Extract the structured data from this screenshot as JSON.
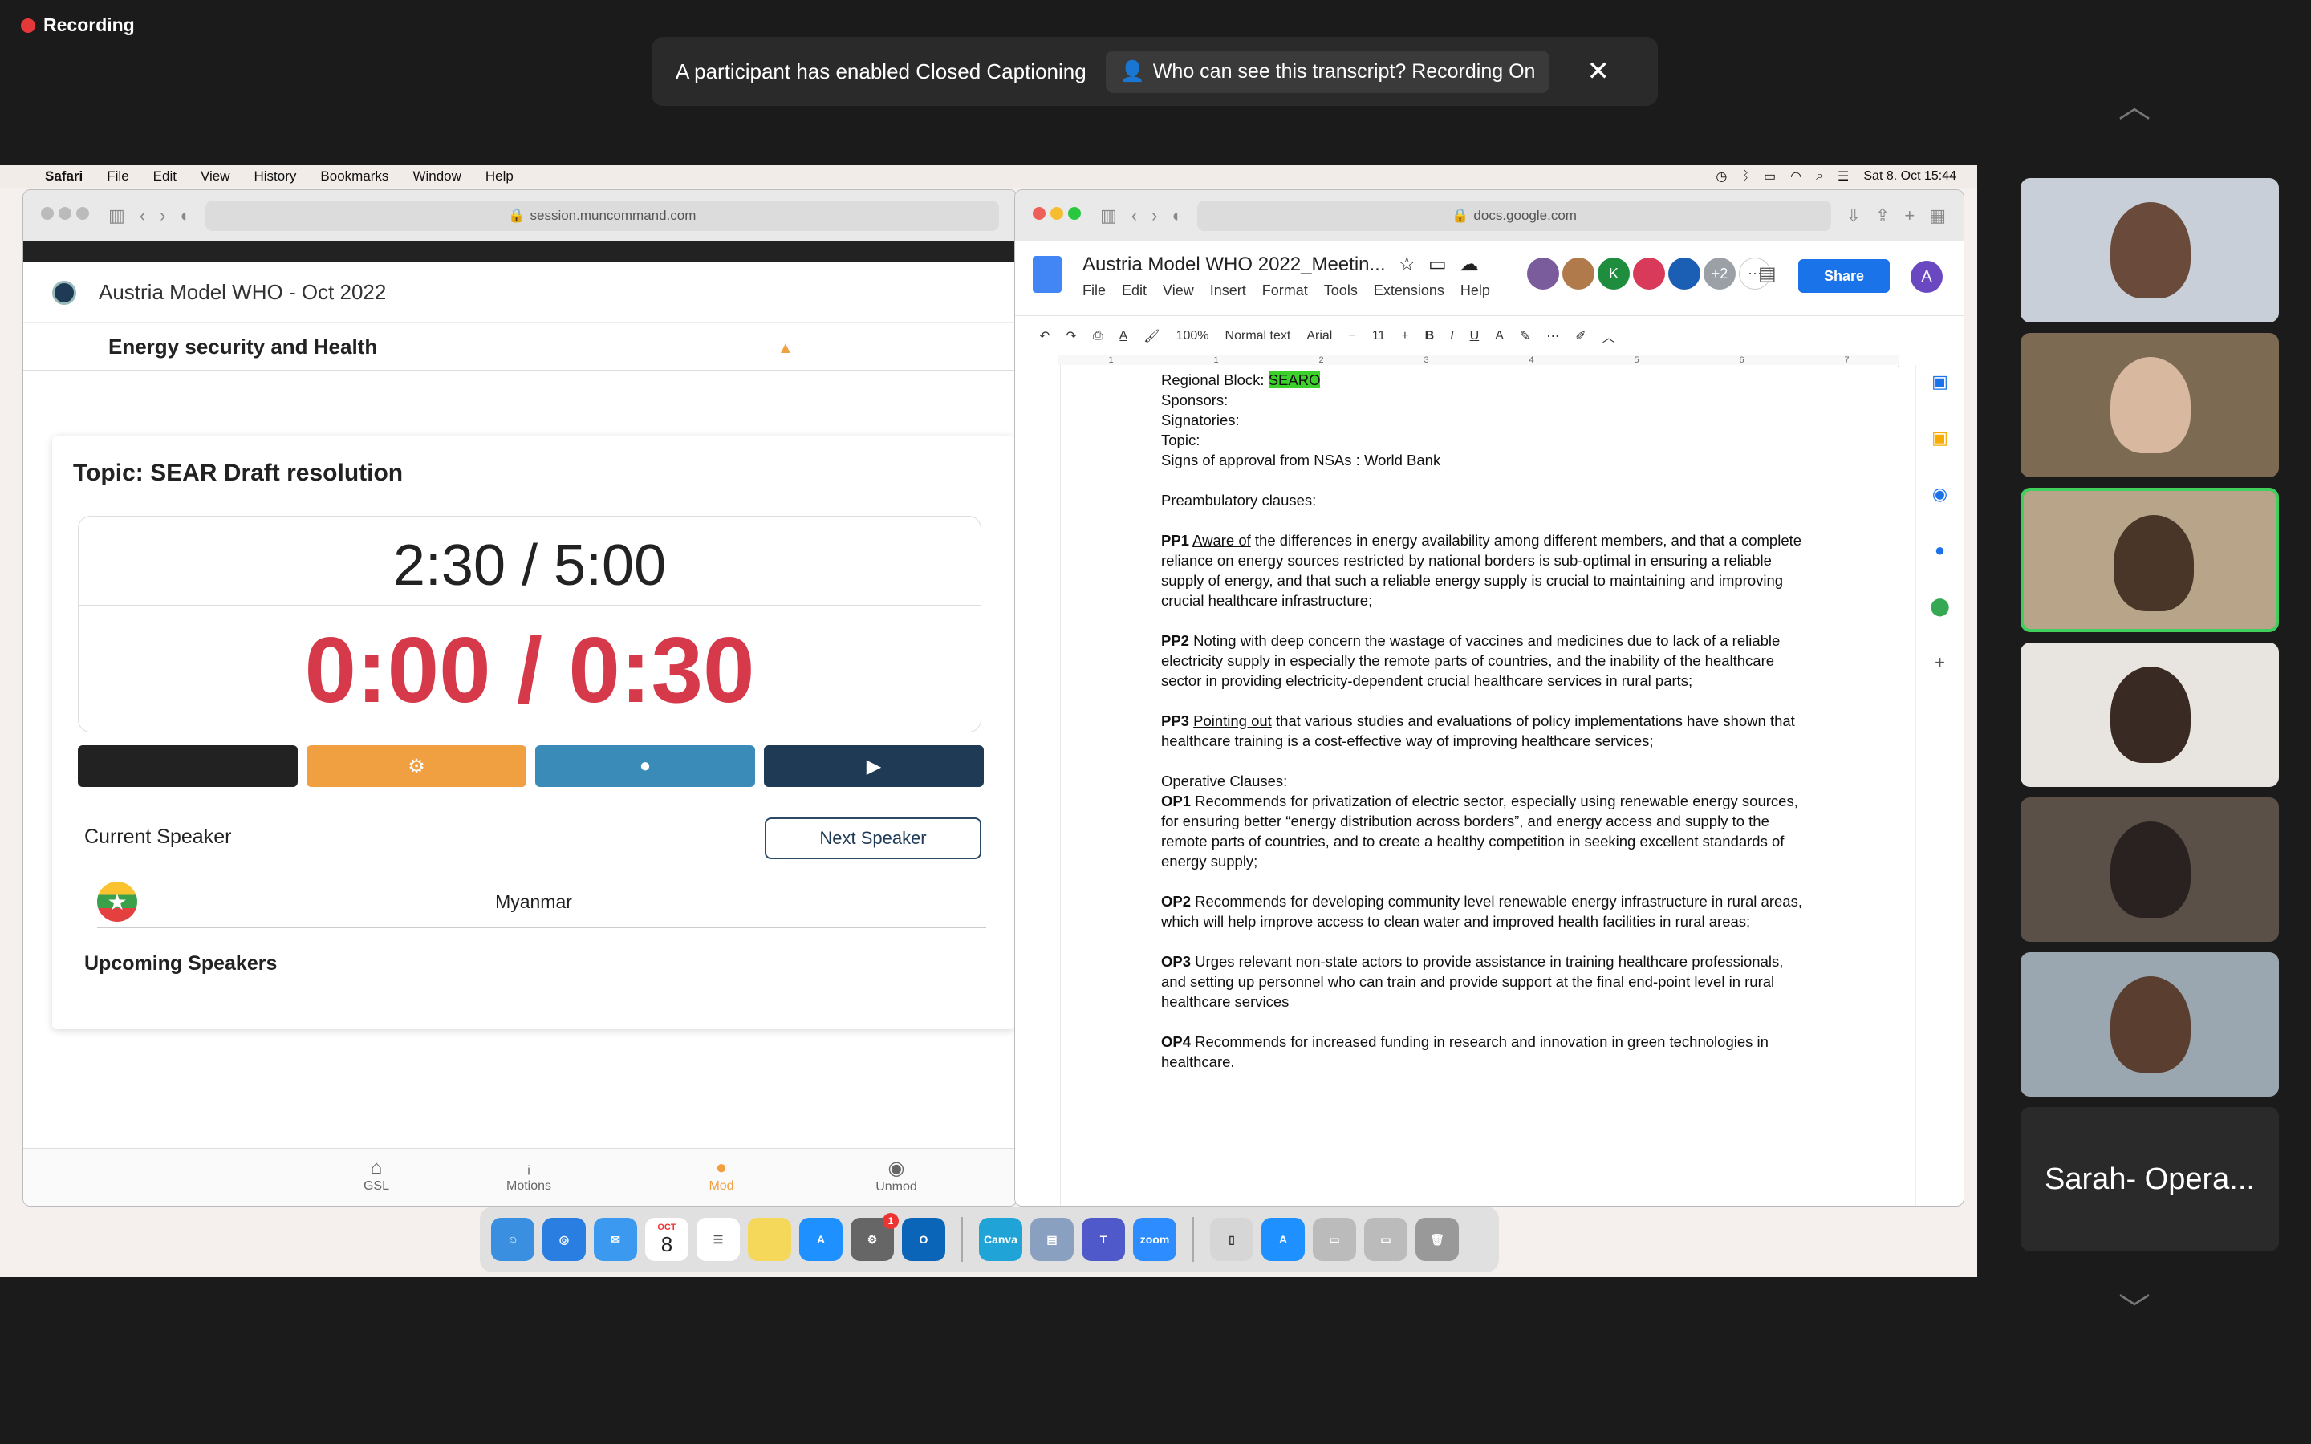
{
  "zoom": {
    "recording_label": "Recording",
    "cc_message": "A participant has enabled Closed Captioning",
    "cc_pill": "Who can see this transcript? Recording On",
    "close_glyph": "✕",
    "participant_name": "Sarah- Opera..."
  },
  "menubar": {
    "app": "Safari",
    "items": [
      "File",
      "Edit",
      "View",
      "History",
      "Bookmarks",
      "Window",
      "Help"
    ],
    "datetime": "Sat 8. Oct  15:44"
  },
  "left_window": {
    "url": "session.muncommand.com",
    "header_title": "Austria Model WHO - Oct 2022",
    "subheader": "Energy security and Health",
    "topic": "Topic: SEAR Draft resolution",
    "main_timer": "2:30 / 5:00",
    "speaker_timer": "0:00 / 0:30",
    "current_speaker_label": "Current Speaker",
    "next_speaker_button": "Next Speaker",
    "current_speaker": "Myanmar",
    "upcoming_label": "Upcoming Speakers",
    "tabs": [
      "GSL",
      "Motions",
      "Mod",
      "Unmod"
    ],
    "control_colors": [
      "#222222",
      "#f0a040",
      "#3a8bb8",
      "#1f3a55"
    ]
  },
  "right_window": {
    "url": "docs.google.com",
    "doc_title": "Austria Model WHO 2022_Meetin...",
    "menu": [
      "File",
      "Edit",
      "View",
      "Insert",
      "Format",
      "Tools",
      "Extensions",
      "Help"
    ],
    "share": "Share",
    "account_initial": "A",
    "avatars_more": "+2",
    "toolbar": {
      "zoom": "100%",
      "style": "Normal text",
      "font": "Arial",
      "size": "11"
    },
    "lines": {
      "regional_label": "Regional Block: ",
      "regional_value": "SEARO",
      "sponsors": "Sponsors:",
      "signatories": "Signatories:",
      "topic": "Topic:",
      "nsa": "Signs of approval from NSAs : World Bank",
      "pre_header": "Preambulatory clauses:",
      "pp1_tag": "PP1",
      "pp1_verb": "Aware of",
      "pp1_text": " the differences in energy availability among different members, and that a complete reliance on energy sources restricted by national borders is sub-optimal in ensuring a reliable supply of energy, and that such a reliable energy supply is crucial to maintaining and improving crucial healthcare infrastructure;",
      "pp2_tag": "PP2",
      "pp2_verb": "Noting",
      "pp2_text": " with deep concern the wastage of vaccines and medicines due to lack of a reliable electricity supply in especially the remote parts of countries, and the inability of the healthcare sector in providing electricity-dependent crucial healthcare services in rural parts;",
      "pp3_tag": "PP3",
      "pp3_verb": "Pointing out",
      "pp3_text": " that various studies and evaluations of policy implementations have shown that healthcare training is a cost-effective way of improving healthcare services;",
      "op_header": "Operative Clauses:",
      "op1_tag": "OP1",
      "op1_text": " Recommends for privatization of electric sector, especially using renewable energy sources, for ensuring better “energy distribution across borders”, and energy access and supply to the remote parts of countries, and to create a healthy competition in seeking excellent standards of energy supply;",
      "op2_tag": "OP2",
      "op2_text": " Recommends for developing community level renewable energy infrastructure in rural areas, which will help improve access to clean water and improved health facilities in rural areas;",
      "op3_tag": "OP3",
      "op3_text": " Urges relevant non-state actors to provide assistance in training healthcare professionals, and setting up personnel who can train and provide support at the final end-point level in rural healthcare services",
      "op4_tag": "OP4",
      "op4_text": " Recommends for increased funding in research and innovation in green technologies in healthcare."
    }
  },
  "dock_labels": {
    "calendar_month": "OCT",
    "calendar_day": "8",
    "canva": "Canva",
    "zoom": "zoom",
    "badge": "1"
  }
}
